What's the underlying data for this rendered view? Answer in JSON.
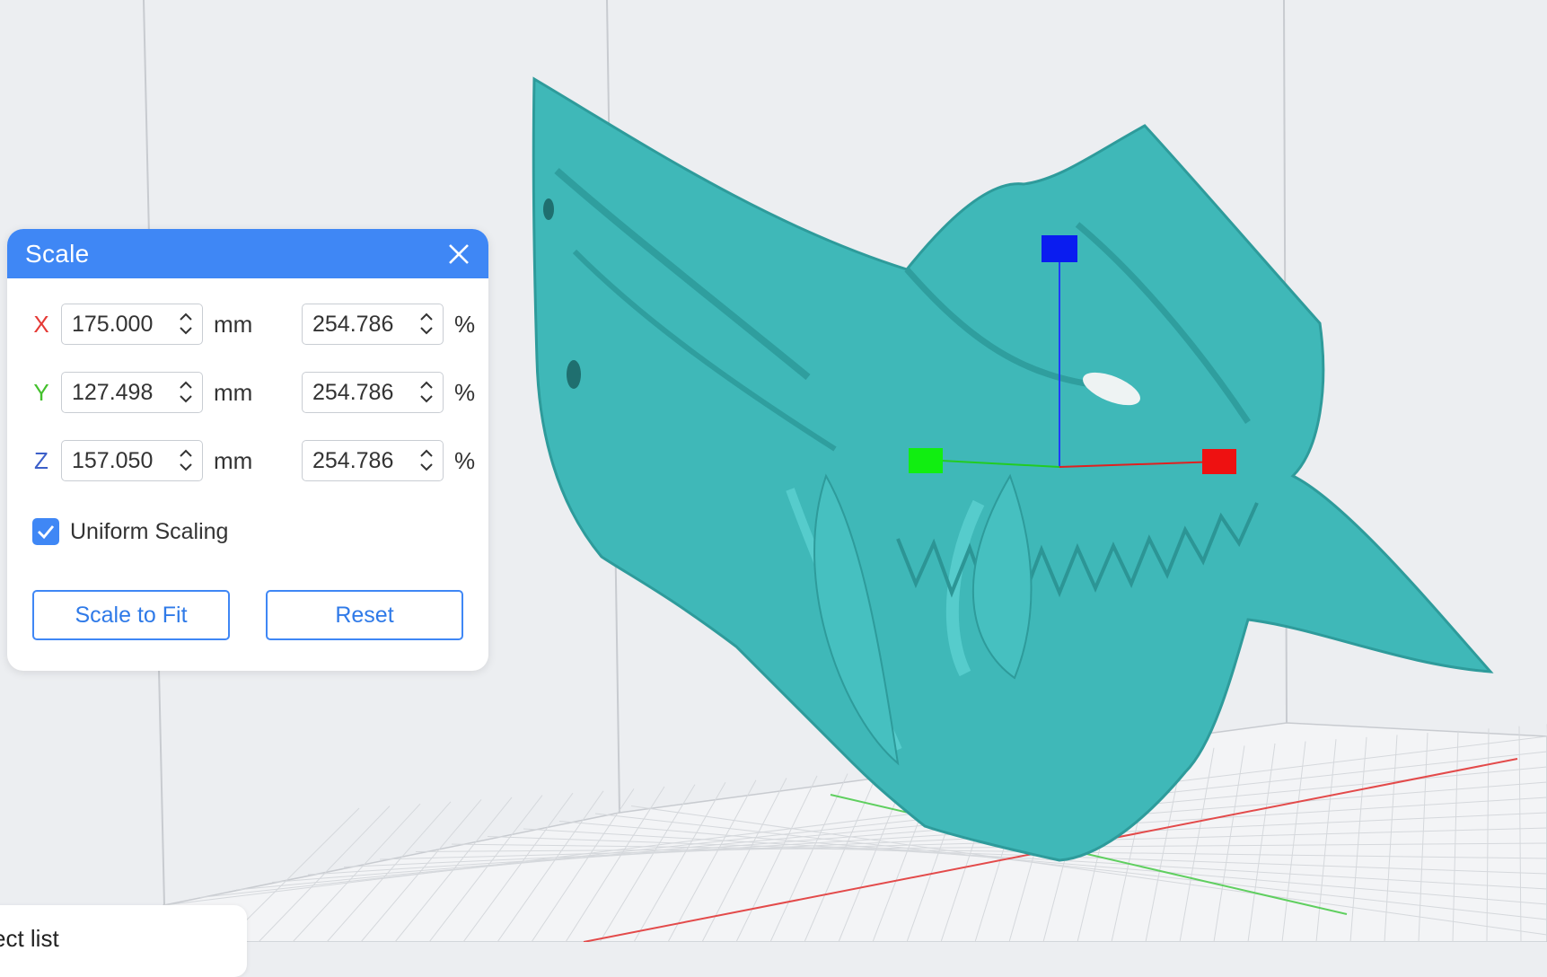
{
  "panel": {
    "title": "Scale",
    "close_icon": "close-icon",
    "rows": [
      {
        "axis": "X",
        "mm": "175.000",
        "mm_unit": "mm",
        "pct": "254.786",
        "pct_unit": "%"
      },
      {
        "axis": "Y",
        "mm": "127.498",
        "mm_unit": "mm",
        "pct": "254.786",
        "pct_unit": "%"
      },
      {
        "axis": "Z",
        "mm": "157.050",
        "mm_unit": "mm",
        "pct": "254.786",
        "pct_unit": "%"
      }
    ],
    "uniform_scaling": {
      "label": "Uniform Scaling",
      "checked": true
    },
    "scale_to_fit_label": "Scale to Fit",
    "reset_label": "Reset"
  },
  "object_list": {
    "label": "ect list"
  },
  "colors": {
    "accent": "#3f87f5",
    "model": "#3fb8b8",
    "axis_x": "#e53935",
    "axis_y": "#43c02c",
    "axis_z": "#3c5fc9",
    "background": "#eceef1"
  }
}
